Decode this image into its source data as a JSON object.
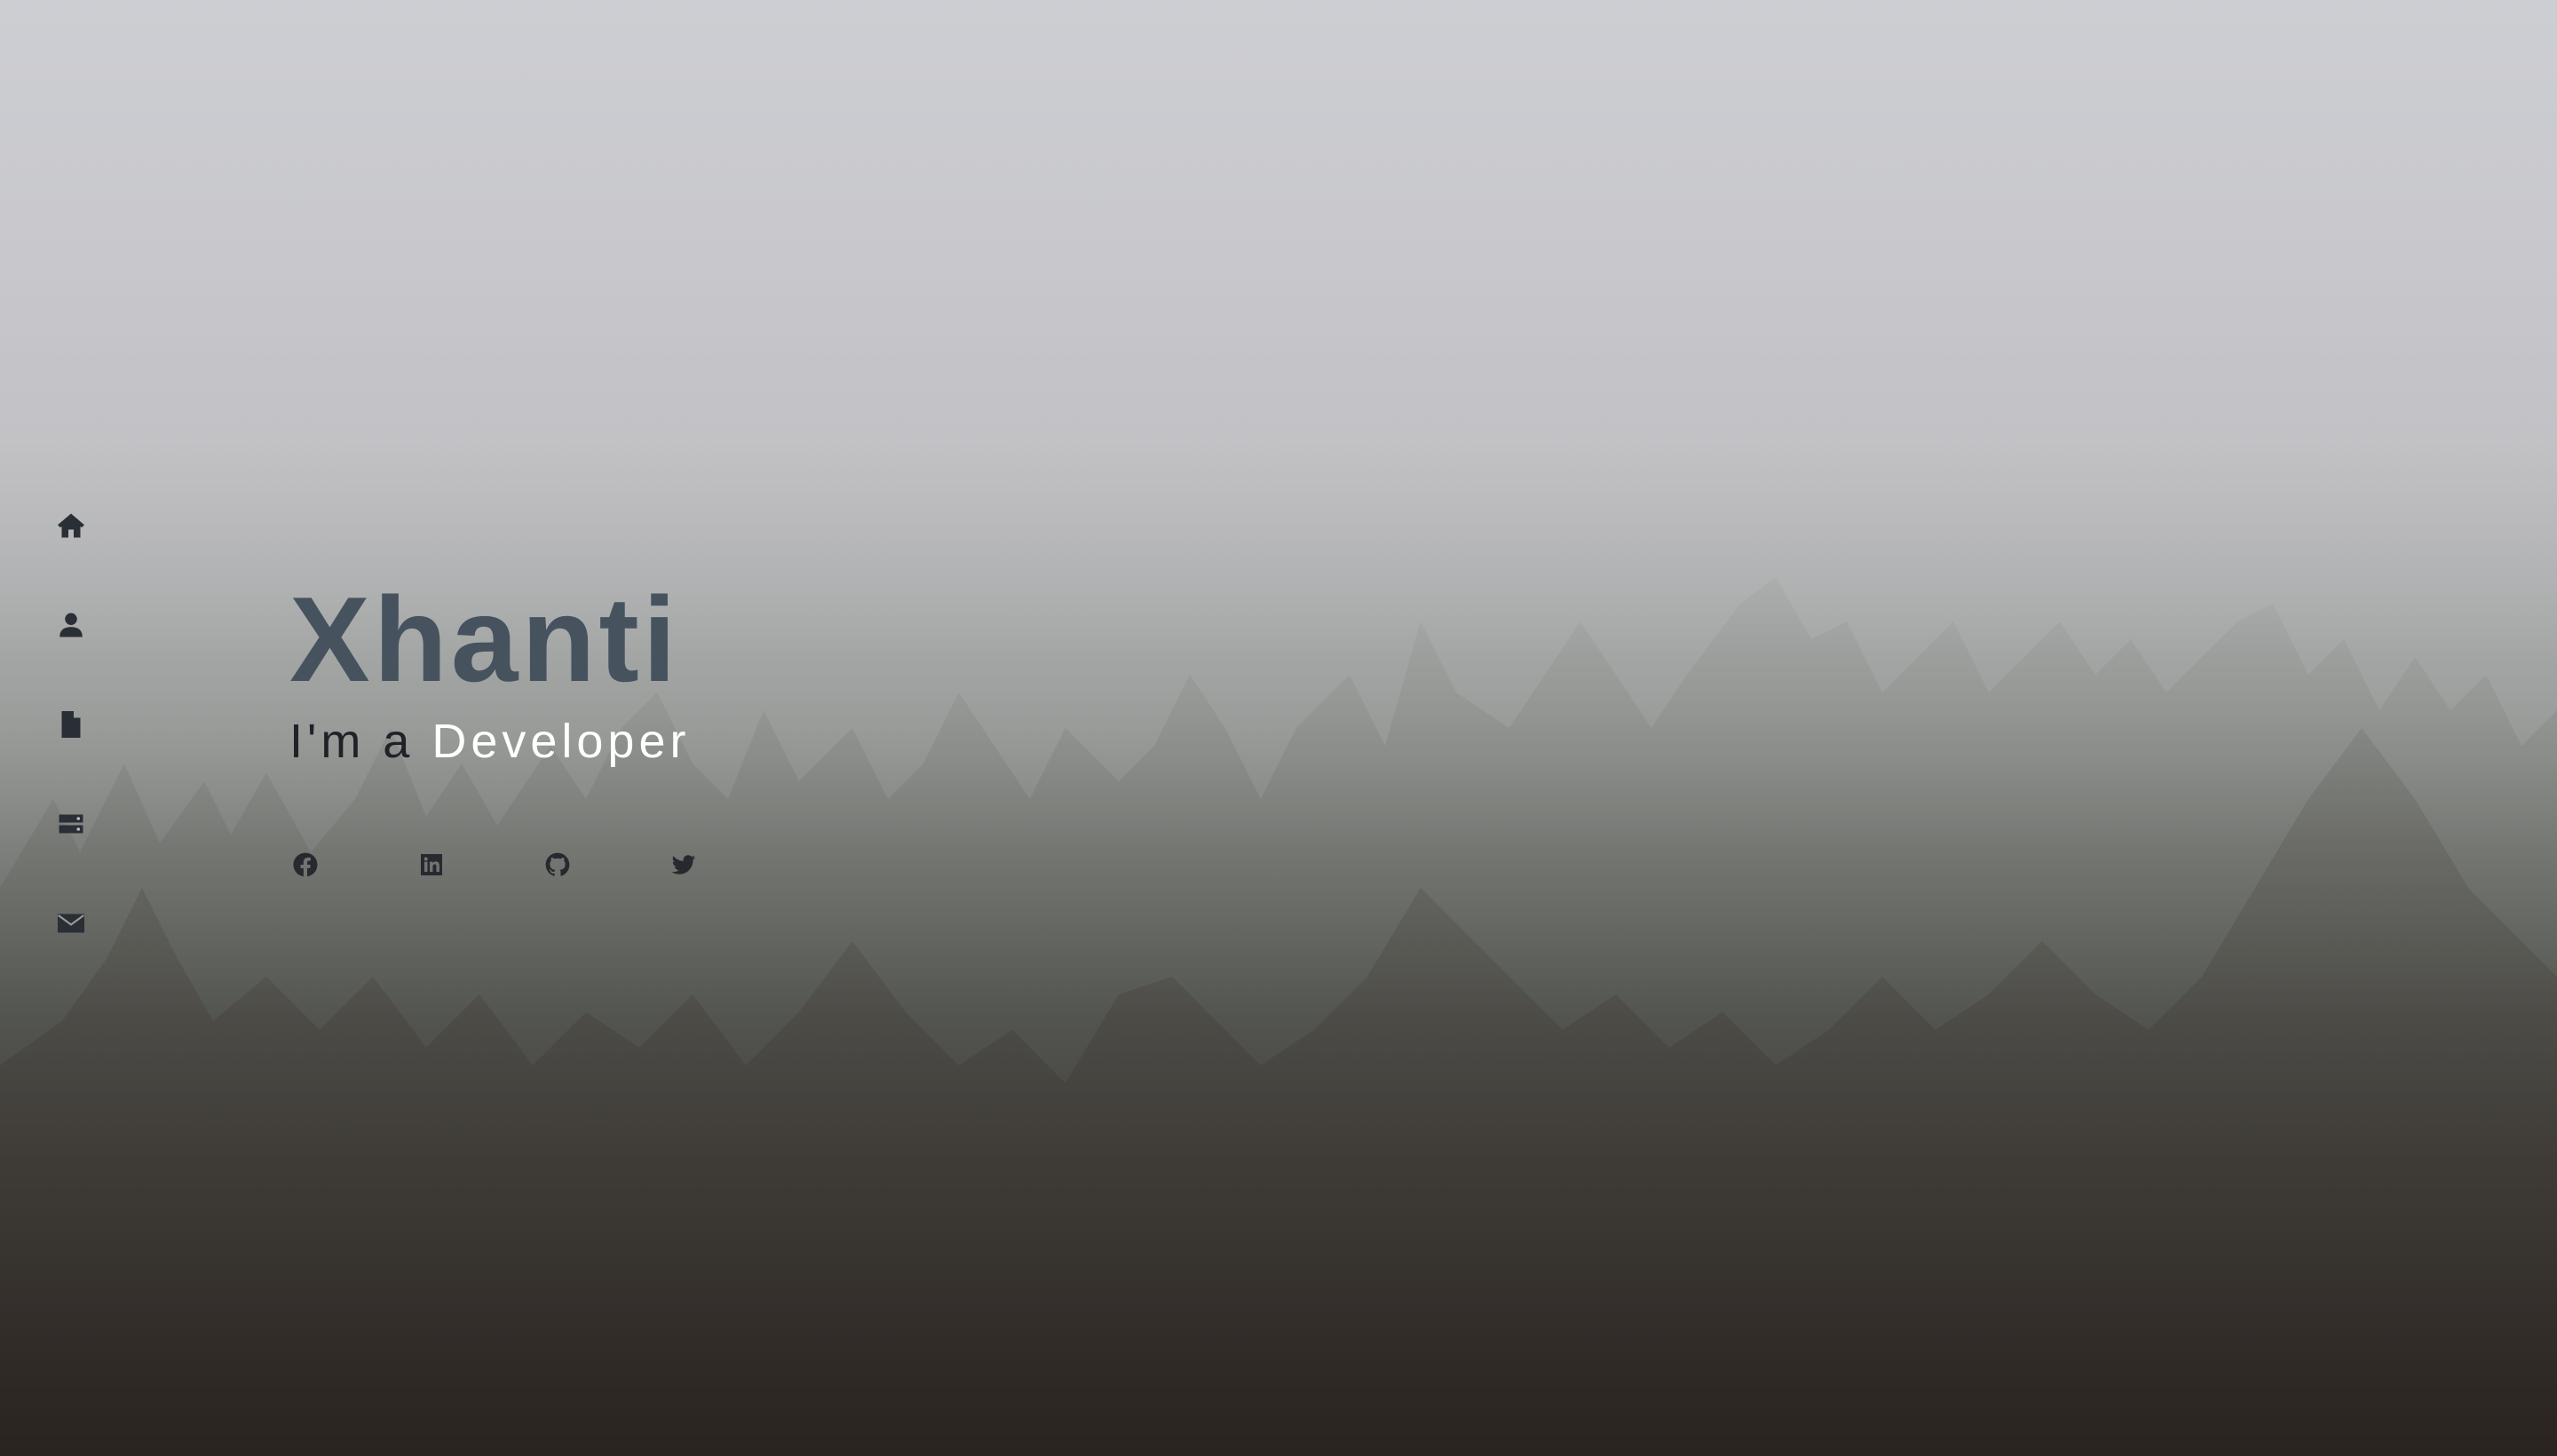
{
  "hero": {
    "name": "Xhanti",
    "tagline_prefix": "I'm a ",
    "tagline_role": "Developer"
  },
  "sidebar": {
    "items": [
      {
        "icon": "home-icon"
      },
      {
        "icon": "user-icon"
      },
      {
        "icon": "document-icon"
      },
      {
        "icon": "server-icon"
      },
      {
        "icon": "envelope-icon"
      }
    ]
  },
  "socials": {
    "items": [
      {
        "icon": "facebook-icon"
      },
      {
        "icon": "linkedin-icon"
      },
      {
        "icon": "github-icon"
      },
      {
        "icon": "twitter-icon"
      }
    ]
  },
  "colors": {
    "name": "#46535f",
    "tagline": "#1f2226",
    "role": "#ffffff",
    "icons": "#2a2f35"
  }
}
